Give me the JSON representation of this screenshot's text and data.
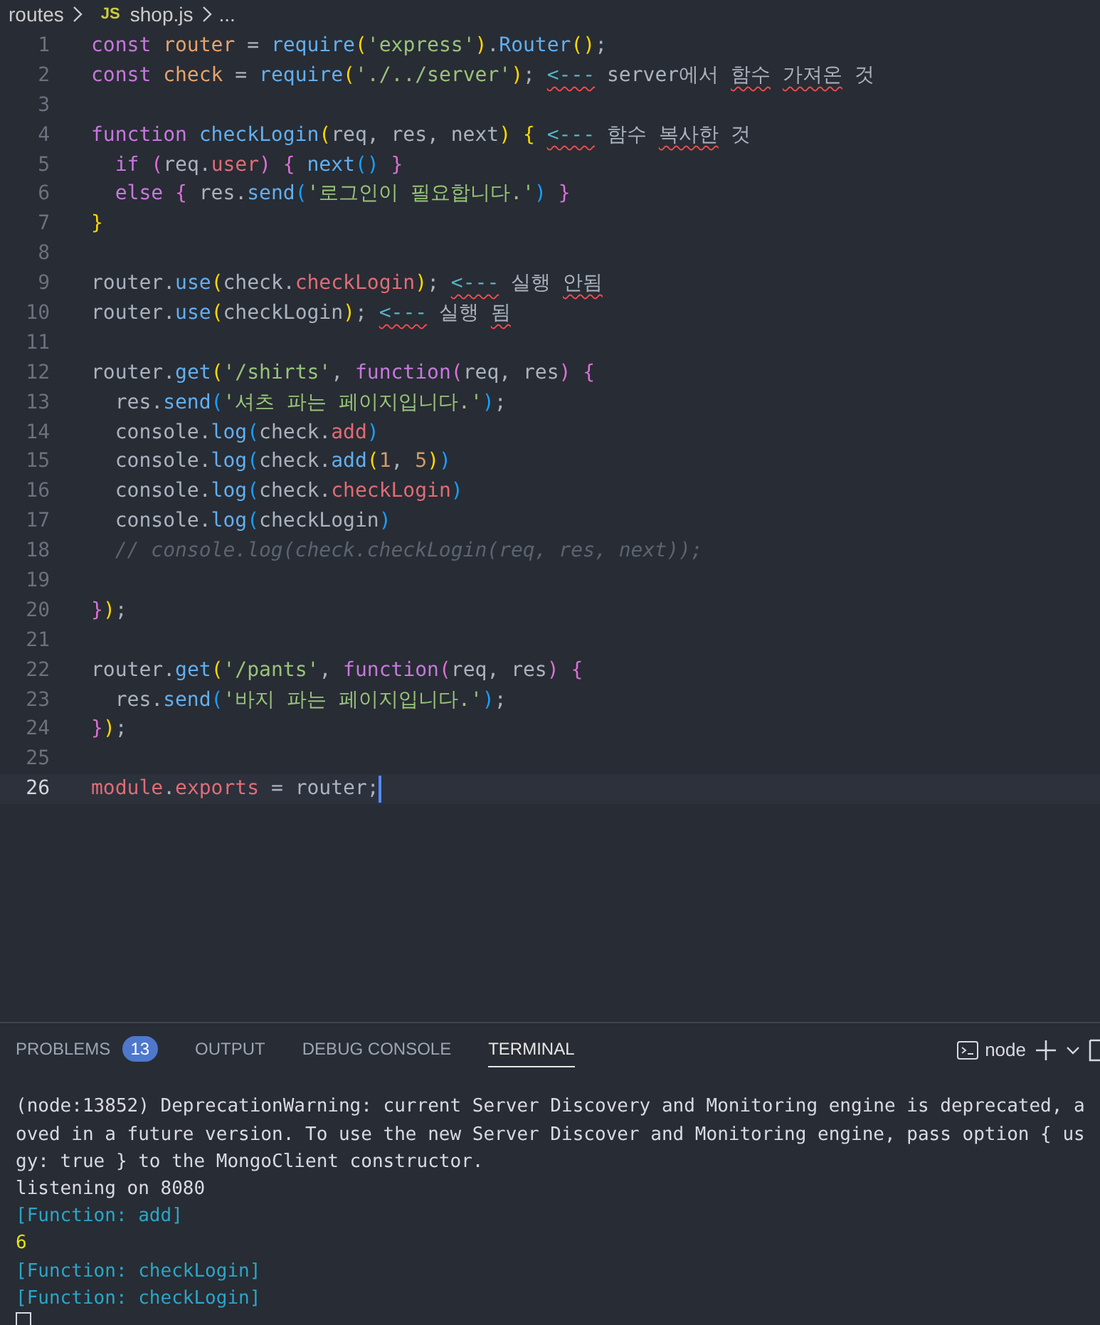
{
  "breadcrumb": [
    {
      "kind": "folder",
      "label": "routes"
    },
    {
      "kind": "file",
      "icon_text": "JS",
      "label": "shop.js"
    },
    {
      "kind": "more",
      "label": "..."
    }
  ],
  "editor": {
    "lines": [
      {
        "number": "1",
        "current": false,
        "tokens": [
          {
            "kind": "kw",
            "text": "const "
          },
          {
            "kind": "var",
            "text": "router"
          },
          {
            "kind": "plain",
            "text": " = "
          },
          {
            "kind": "fn",
            "text": "require"
          },
          {
            "kind": "b1",
            "text": "("
          },
          {
            "kind": "str",
            "text": "'express'"
          },
          {
            "kind": "b1",
            "text": ")"
          },
          {
            "kind": "plain",
            "text": "."
          },
          {
            "kind": "fn",
            "text": "Router"
          },
          {
            "kind": "b1",
            "text": "()"
          },
          {
            "kind": "plain",
            "text": ";"
          }
        ]
      },
      {
        "number": "2",
        "current": false,
        "tokens": [
          {
            "kind": "kw",
            "text": "const "
          },
          {
            "kind": "var",
            "text": "check"
          },
          {
            "kind": "plain",
            "text": " = "
          },
          {
            "kind": "fn",
            "text": "require"
          },
          {
            "kind": "b1",
            "text": "("
          },
          {
            "kind": "str",
            "text": "'./../server'"
          },
          {
            "kind": "b1",
            "text": ")"
          },
          {
            "kind": "plain",
            "text": "; "
          },
          {
            "kind": "arrow",
            "text": "<---",
            "squiggle": true
          },
          {
            "kind": "plain",
            "text": " server에서 "
          },
          {
            "kind": "plain",
            "text": "함수 ",
            "squiggle": true
          },
          {
            "kind": "plain",
            "text": "가져온",
            "squiggle": true
          },
          {
            "kind": "plain",
            "text": " 것"
          }
        ]
      },
      {
        "number": "3",
        "current": false
      },
      {
        "number": "4",
        "current": false,
        "tokens": [
          {
            "kind": "kw",
            "text": "function "
          },
          {
            "kind": "fn",
            "text": "checkLogin"
          },
          {
            "kind": "b1",
            "text": "("
          },
          {
            "kind": "plain",
            "text": "req, res, next"
          },
          {
            "kind": "b1",
            "text": ") "
          },
          {
            "kind": "b1",
            "text": "{ "
          },
          {
            "kind": "arrow",
            "text": "<---",
            "squiggle": true
          },
          {
            "kind": "plain",
            "text": " 함수 "
          },
          {
            "kind": "plain",
            "text": "복사한",
            "squiggle": true
          },
          {
            "kind": "plain",
            "text": " 것"
          }
        ]
      },
      {
        "number": "5",
        "current": false,
        "tokens": [
          {
            "kind": "kw",
            "text": "  if "
          },
          {
            "kind": "b2",
            "text": "("
          },
          {
            "kind": "plain",
            "text": "req."
          },
          {
            "kind": "prop",
            "text": "user"
          },
          {
            "kind": "b2",
            "text": ") "
          },
          {
            "kind": "b2",
            "text": "{ "
          },
          {
            "kind": "fn",
            "text": "next"
          },
          {
            "kind": "b3",
            "text": "() "
          },
          {
            "kind": "b2",
            "text": "}"
          }
        ]
      },
      {
        "number": "6",
        "current": false,
        "tokens": [
          {
            "kind": "kw",
            "text": "  else "
          },
          {
            "kind": "b2",
            "text": "{"
          },
          {
            "kind": "plain",
            "text": " res."
          },
          {
            "kind": "fn",
            "text": "send"
          },
          {
            "kind": "b3",
            "text": "("
          },
          {
            "kind": "str",
            "text": "'로그인이 필요합니다.'"
          },
          {
            "kind": "b3",
            "text": ") "
          },
          {
            "kind": "b2",
            "text": "}"
          }
        ]
      },
      {
        "number": "7",
        "current": false,
        "tokens": [
          {
            "kind": "b1",
            "text": "}"
          }
        ]
      },
      {
        "number": "8",
        "current": false
      },
      {
        "number": "9",
        "current": false,
        "tokens": [
          {
            "kind": "plain",
            "text": "router."
          },
          {
            "kind": "fn",
            "text": "use"
          },
          {
            "kind": "b1",
            "text": "("
          },
          {
            "kind": "plain",
            "text": "check."
          },
          {
            "kind": "prop",
            "text": "checkLogin"
          },
          {
            "kind": "b1",
            "text": ")"
          },
          {
            "kind": "plain",
            "text": "; "
          },
          {
            "kind": "arrow",
            "text": "<---",
            "squiggle": true
          },
          {
            "kind": "plain",
            "text": " 실행 "
          },
          {
            "kind": "plain",
            "text": "안됨",
            "squiggle": true
          }
        ]
      },
      {
        "number": "10",
        "current": false,
        "tokens": [
          {
            "kind": "plain",
            "text": "router."
          },
          {
            "kind": "fn",
            "text": "use"
          },
          {
            "kind": "b1",
            "text": "("
          },
          {
            "kind": "plain",
            "text": "checkLogin"
          },
          {
            "kind": "b1",
            "text": ")"
          },
          {
            "kind": "plain",
            "text": "; "
          },
          {
            "kind": "arrow",
            "text": "<---",
            "squiggle": true
          },
          {
            "kind": "plain",
            "text": " 실행 "
          },
          {
            "kind": "plain",
            "text": "됨",
            "squiggle": true
          }
        ]
      },
      {
        "number": "11",
        "current": false
      },
      {
        "number": "12",
        "current": false,
        "tokens": [
          {
            "kind": "plain",
            "text": "router."
          },
          {
            "kind": "fn",
            "text": "get"
          },
          {
            "kind": "b1",
            "text": "("
          },
          {
            "kind": "str",
            "text": "'/shirts'"
          },
          {
            "kind": "plain",
            "text": ", "
          },
          {
            "kind": "kw",
            "text": "function"
          },
          {
            "kind": "b2",
            "text": "("
          },
          {
            "kind": "plain",
            "text": "req, res"
          },
          {
            "kind": "b2",
            "text": ") "
          },
          {
            "kind": "b2",
            "text": "{"
          }
        ]
      },
      {
        "number": "13",
        "current": false,
        "tokens": [
          {
            "kind": "plain",
            "text": "  res."
          },
          {
            "kind": "fn",
            "text": "send"
          },
          {
            "kind": "b3",
            "text": "("
          },
          {
            "kind": "str",
            "text": "'셔츠 파는 페이지입니다.'"
          },
          {
            "kind": "b3",
            "text": ")"
          },
          {
            "kind": "plain",
            "text": ";"
          }
        ]
      },
      {
        "number": "14",
        "current": false,
        "tokens": [
          {
            "kind": "plain",
            "text": "  console."
          },
          {
            "kind": "fn",
            "text": "log"
          },
          {
            "kind": "b3",
            "text": "("
          },
          {
            "kind": "plain",
            "text": "check."
          },
          {
            "kind": "prop",
            "text": "add"
          },
          {
            "kind": "b3",
            "text": ")"
          }
        ]
      },
      {
        "number": "15",
        "current": false,
        "tokens": [
          {
            "kind": "plain",
            "text": "  console."
          },
          {
            "kind": "fn",
            "text": "log"
          },
          {
            "kind": "b3",
            "text": "("
          },
          {
            "kind": "plain",
            "text": "check."
          },
          {
            "kind": "fn",
            "text": "add"
          },
          {
            "kind": "b1",
            "text": "("
          },
          {
            "kind": "num",
            "text": "1"
          },
          {
            "kind": "plain",
            "text": ", "
          },
          {
            "kind": "num",
            "text": "5"
          },
          {
            "kind": "b1",
            "text": ")"
          },
          {
            "kind": "b3",
            "text": ")"
          }
        ]
      },
      {
        "number": "16",
        "current": false,
        "tokens": [
          {
            "kind": "plain",
            "text": "  console."
          },
          {
            "kind": "fn",
            "text": "log"
          },
          {
            "kind": "b3",
            "text": "("
          },
          {
            "kind": "plain",
            "text": "check."
          },
          {
            "kind": "prop",
            "text": "checkLogin"
          },
          {
            "kind": "b3",
            "text": ")"
          }
        ]
      },
      {
        "number": "17",
        "current": false,
        "tokens": [
          {
            "kind": "plain",
            "text": "  console."
          },
          {
            "kind": "fn",
            "text": "log"
          },
          {
            "kind": "b3",
            "text": "("
          },
          {
            "kind": "plain",
            "text": "checkLogin"
          },
          {
            "kind": "b3",
            "text": ")"
          }
        ]
      },
      {
        "number": "18",
        "current": false,
        "tokens": [
          {
            "kind": "comment",
            "text": "  // console.log(check.checkLogin(req, res, next));"
          }
        ]
      },
      {
        "number": "19",
        "current": false
      },
      {
        "number": "20",
        "current": false,
        "tokens": [
          {
            "kind": "b2",
            "text": "}"
          },
          {
            "kind": "b1",
            "text": ")"
          },
          {
            "kind": "plain",
            "text": ";"
          }
        ]
      },
      {
        "number": "21",
        "current": false
      },
      {
        "number": "22",
        "current": false,
        "tokens": [
          {
            "kind": "plain",
            "text": "router."
          },
          {
            "kind": "fn",
            "text": "get"
          },
          {
            "kind": "b1",
            "text": "("
          },
          {
            "kind": "str",
            "text": "'/pants'"
          },
          {
            "kind": "plain",
            "text": ", "
          },
          {
            "kind": "kw",
            "text": "function"
          },
          {
            "kind": "b2",
            "text": "("
          },
          {
            "kind": "plain",
            "text": "req, res"
          },
          {
            "kind": "b2",
            "text": ") "
          },
          {
            "kind": "b2",
            "text": "{"
          }
        ]
      },
      {
        "number": "23",
        "current": false,
        "tokens": [
          {
            "kind": "plain",
            "text": "  res."
          },
          {
            "kind": "fn",
            "text": "send"
          },
          {
            "kind": "b3",
            "text": "("
          },
          {
            "kind": "str",
            "text": "'바지 파는 페이지입니다.'"
          },
          {
            "kind": "b3",
            "text": ")"
          },
          {
            "kind": "plain",
            "text": ";"
          }
        ]
      },
      {
        "number": "24",
        "current": false,
        "tokens": [
          {
            "kind": "b2",
            "text": "}"
          },
          {
            "kind": "b1",
            "text": ")"
          },
          {
            "kind": "plain",
            "text": ";"
          }
        ]
      },
      {
        "number": "25",
        "current": false
      },
      {
        "number": "26",
        "current": true,
        "tokens": [
          {
            "kind": "prop",
            "text": "module"
          },
          {
            "kind": "plain",
            "text": "."
          },
          {
            "kind": "prop",
            "text": "exports"
          },
          {
            "kind": "plain",
            "text": " = router;"
          }
        ]
      }
    ]
  },
  "panel": {
    "tabs": [
      {
        "label": "PROBLEMS",
        "badge": "13",
        "selected": false
      },
      {
        "label": "OUTPUT",
        "selected": false
      },
      {
        "label": "DEBUG CONSOLE",
        "selected": false
      },
      {
        "label": "TERMINAL",
        "selected": true
      }
    ],
    "terminal_name": "node",
    "terminal": [
      {
        "kind": "plain",
        "text": "(node:13852) DeprecationWarning: current Server Discovery and Monitoring engine is deprecated, a"
      },
      {
        "kind": "plain",
        "text": "oved in a future version. To use the new Server Discover and Monitoring engine, pass option { us"
      },
      {
        "kind": "plain",
        "text": "gy: true } to the MongoClient constructor."
      },
      {
        "kind": "plain",
        "text": "listening on 8080"
      },
      {
        "kind": "function",
        "text": "[Function: add]"
      },
      {
        "kind": "number",
        "text": "6"
      },
      {
        "kind": "function",
        "text": "[Function: checkLogin]"
      },
      {
        "kind": "function",
        "text": "[Function: checkLogin]"
      }
    ]
  }
}
